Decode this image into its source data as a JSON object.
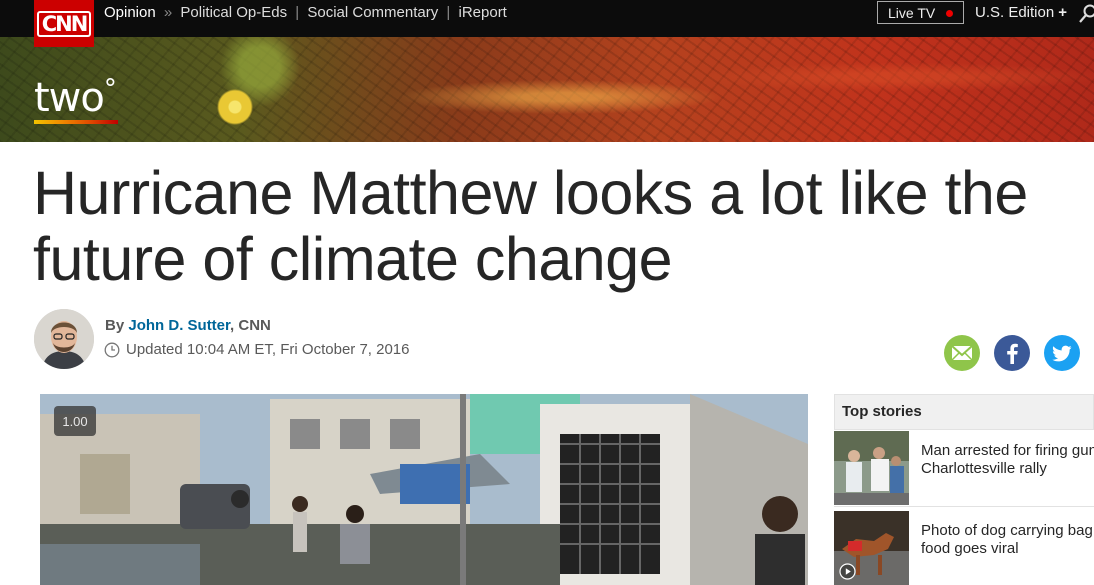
{
  "nav": {
    "logo": "CNN",
    "section": "Opinion",
    "separator": "»",
    "links": [
      "Political Op-Eds",
      "Social Commentary",
      "iReport"
    ],
    "live_tv": "Live TV",
    "edition": "U.S. Edition",
    "edition_plus": "+"
  },
  "banner": {
    "logo_text": "two",
    "logo_degree": "°"
  },
  "article": {
    "headline_line1": "Hurricane Matthew looks a lot like the",
    "headline_line2": "future of climate change",
    "by": "By",
    "author": "John D. Sutter",
    "outlet": ", CNN",
    "updated": "Updated 10:04 AM ET, Fri October 7, 2016"
  },
  "video": {
    "speed": "1.00"
  },
  "top_stories": {
    "title": "Top stories",
    "items": [
      {
        "line1": "Man arrested for firing gun",
        "line2": "Charlottesville rally"
      },
      {
        "line1": "Photo of dog carrying bag",
        "line2": "food goes viral"
      }
    ]
  },
  "colors": {
    "cnn_red": "#cc0000",
    "link_blue": "#006699",
    "email_green": "#8fc54a",
    "facebook": "#3b5998",
    "twitter": "#1ba1f2"
  }
}
